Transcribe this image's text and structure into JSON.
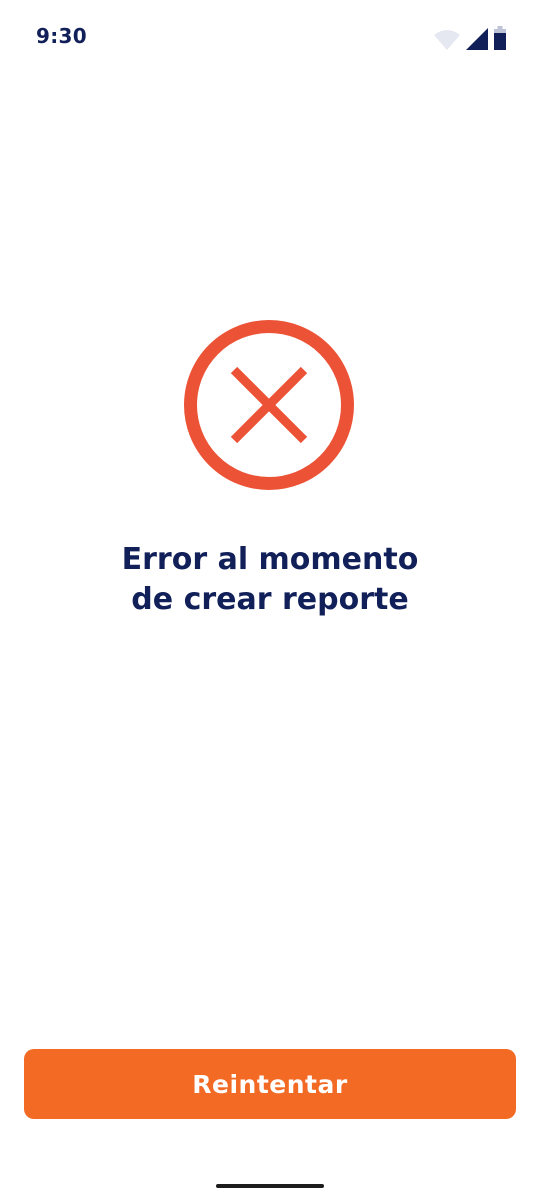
{
  "status_bar": {
    "time": "9:30",
    "icons": [
      "wifi-icon",
      "cellular-signal-icon",
      "battery-icon"
    ]
  },
  "error": {
    "icon": "error-x-circle-icon",
    "icon_color": "#EC5236",
    "title_line1": "Error al momento",
    "title_line2": "de crear reporte",
    "title_color": "#12205A"
  },
  "actions": {
    "retry_label": "Reintentar",
    "retry_color": "#F26A24"
  }
}
